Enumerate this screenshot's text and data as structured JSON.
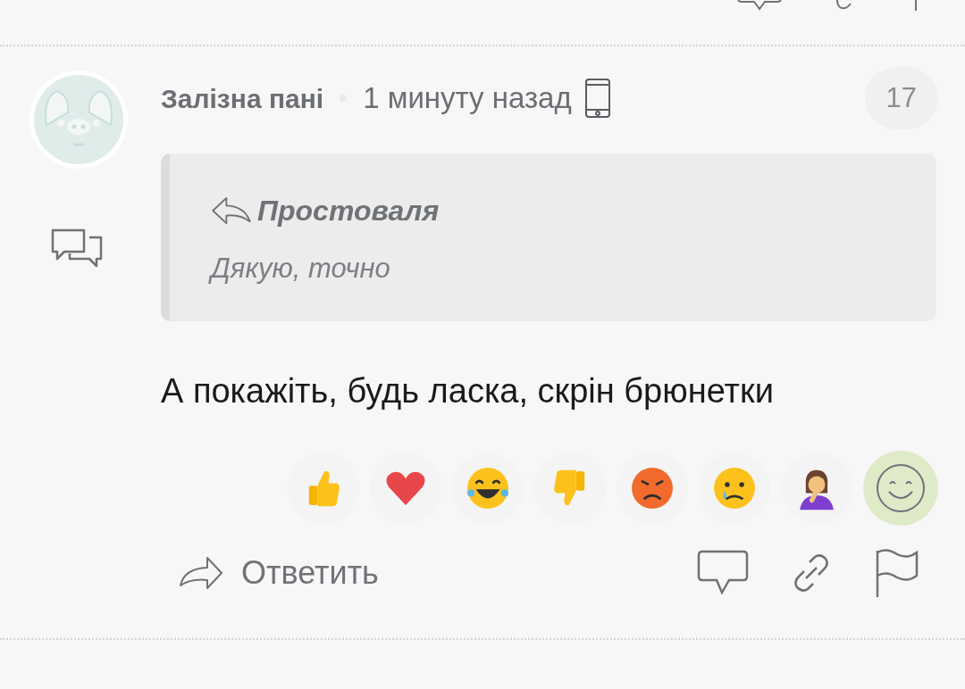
{
  "comment": {
    "author": "Залізна пані",
    "time": "1 минуту назад",
    "rating": "17",
    "quote": {
      "author": "Простоваля",
      "text": "Дякую, точно"
    },
    "body": "А покажіть, будь ласка, скрін брюнетки",
    "reactions": [
      {
        "kind": "thumbs-up"
      },
      {
        "kind": "heart"
      },
      {
        "kind": "laugh"
      },
      {
        "kind": "thumbs-down"
      },
      {
        "kind": "angry"
      },
      {
        "kind": "cry"
      },
      {
        "kind": "facepalm"
      }
    ],
    "reply_label": "Ответить"
  }
}
